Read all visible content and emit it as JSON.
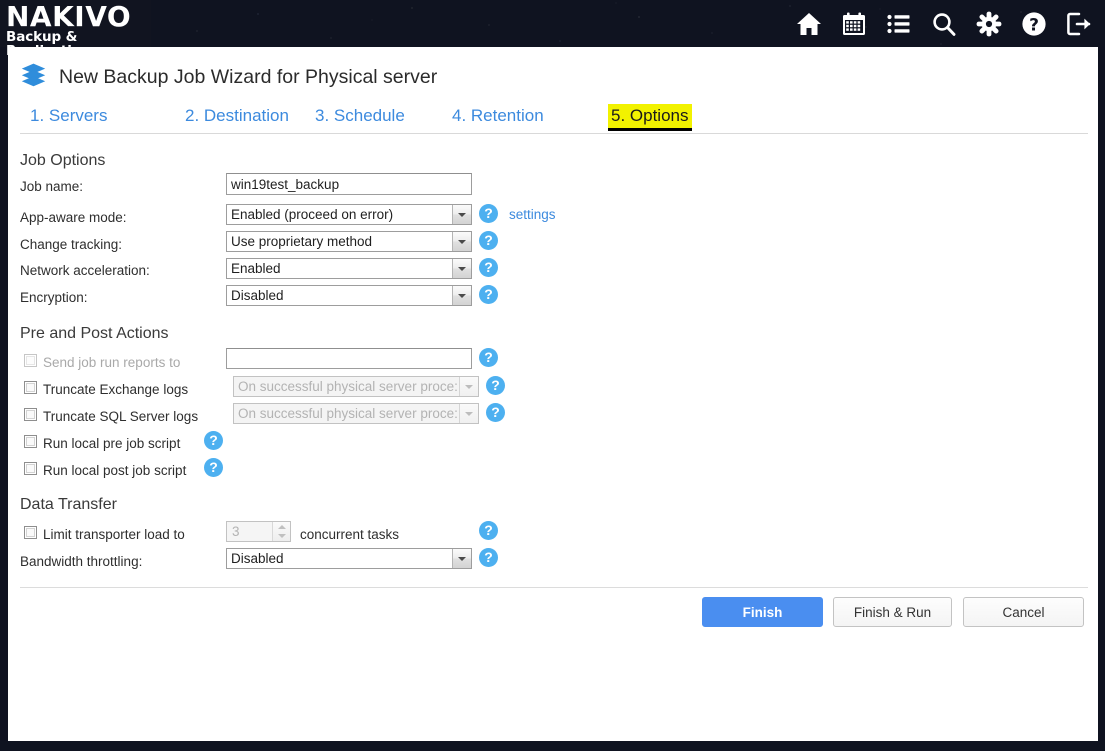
{
  "header": {
    "logo_brand": "NAKIVO",
    "logo_tagline": "Backup & Replication",
    "icons": [
      {
        "name": "home-icon",
        "label": "Home"
      },
      {
        "name": "calendar-icon",
        "label": "Calendar"
      },
      {
        "name": "list-icon",
        "label": "Jobs list"
      },
      {
        "name": "search-icon",
        "label": "Search"
      },
      {
        "name": "gear-icon",
        "label": "Settings"
      },
      {
        "name": "help-icon",
        "label": "Help"
      },
      {
        "name": "logout-icon",
        "label": "Log out"
      }
    ]
  },
  "wizard": {
    "title": "New Backup Job Wizard for Physical server",
    "icon": "stacked-layers-icon",
    "tabs": [
      {
        "label": "1. Servers",
        "active": false
      },
      {
        "label": "2. Destination",
        "active": false
      },
      {
        "label": "3. Schedule",
        "active": false
      },
      {
        "label": "4. Retention",
        "active": false
      },
      {
        "label": "5. Options",
        "active": true
      }
    ],
    "active_tab_highlight": "#f2f200"
  },
  "job_options": {
    "heading": "Job Options",
    "job_name_label": "Job name:",
    "job_name_value": "win19test_backup",
    "job_name_placeholder": "",
    "app_aware_label": "App-aware mode:",
    "app_aware_value": "Enabled (proceed on error)",
    "app_aware_settings_link": "settings",
    "change_tracking_label": "Change tracking:",
    "change_tracking_value": "Use proprietary method",
    "network_accel_label": "Network acceleration:",
    "network_accel_value": "Enabled",
    "encryption_label": "Encryption:",
    "encryption_value": "Disabled",
    "help_glyph": "?"
  },
  "pre_post_actions": {
    "heading": "Pre and Post Actions",
    "send_reports_label": "Send job run reports to",
    "send_reports_value": "",
    "send_reports_placeholder": "",
    "send_reports_checked": false,
    "send_reports_disabled": true,
    "truncate_exchange_label": "Truncate Exchange logs",
    "truncate_exchange_value": "On successful physical server proce:",
    "truncate_exchange_checked": false,
    "truncate_sql_label": "Truncate SQL Server logs",
    "truncate_sql_value": "On successful physical server proce:",
    "truncate_sql_checked": false,
    "pre_script_label": "Run local pre job script",
    "pre_script_checked": false,
    "post_script_label": "Run local post job script",
    "post_script_checked": false
  },
  "data_transfer": {
    "heading": "Data Transfer",
    "limit_label": "Limit transporter load to",
    "limit_checked": false,
    "limit_value": "3",
    "limit_suffix": "concurrent tasks",
    "bandwidth_label": "Bandwidth throttling:",
    "bandwidth_value": "Disabled"
  },
  "footer": {
    "finish_label": "Finish",
    "finish_run_label": "Finish & Run",
    "cancel_label": "Cancel",
    "primary_color": "#4a8ef0"
  }
}
